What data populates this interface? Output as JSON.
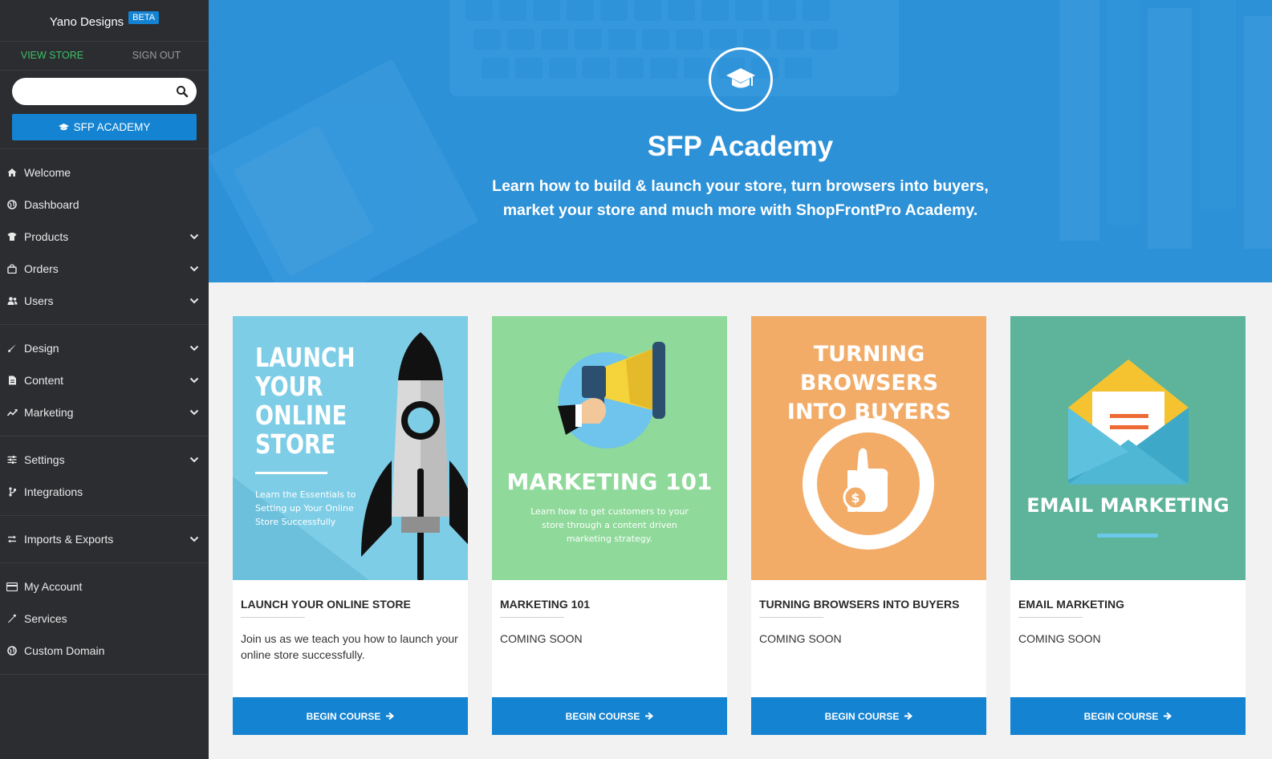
{
  "sidebar": {
    "brand": "Yano Designs",
    "beta_badge": "BETA",
    "view_store": "VIEW STORE",
    "sign_out": "SIGN OUT",
    "search_placeholder": "",
    "academy_button": "SFP ACADEMY",
    "groups": [
      [
        {
          "label": "Welcome",
          "icon": "home-icon",
          "expandable": false
        },
        {
          "label": "Dashboard",
          "icon": "globe-icon",
          "expandable": false
        },
        {
          "label": "Products",
          "icon": "shirt-icon",
          "expandable": true
        },
        {
          "label": "Orders",
          "icon": "bag-icon",
          "expandable": true
        },
        {
          "label": "Users",
          "icon": "users-icon",
          "expandable": true
        }
      ],
      [
        {
          "label": "Design",
          "icon": "brush-icon",
          "expandable": true
        },
        {
          "label": "Content",
          "icon": "document-icon",
          "expandable": true
        },
        {
          "label": "Marketing",
          "icon": "trend-icon",
          "expandable": true
        }
      ],
      [
        {
          "label": "Settings",
          "icon": "sliders-icon",
          "expandable": true
        },
        {
          "label": "Integrations",
          "icon": "branch-icon",
          "expandable": false
        }
      ],
      [
        {
          "label": "Imports & Exports",
          "icon": "exchange-icon",
          "expandable": true
        }
      ],
      [
        {
          "label": "My Account",
          "icon": "card-icon",
          "expandable": false
        },
        {
          "label": "Services",
          "icon": "wrench-icon",
          "expandable": false
        },
        {
          "label": "Custom Domain",
          "icon": "globe-icon",
          "expandable": false
        }
      ]
    ]
  },
  "hero": {
    "title": "SFP Academy",
    "subtitle": "Learn how to build & launch your store, turn browsers into buyers, market your store and much more with ShopFrontPro Academy."
  },
  "cards": [
    {
      "title": "LAUNCH YOUR ONLINE STORE",
      "description": "Join us as we teach you how to launch your online store successfully.",
      "button": "BEGIN COURSE",
      "image": {
        "bg": "#7ecde6",
        "heading": "LAUNCH YOUR ONLINE STORE",
        "caption": "Learn the Essentials to Setting up Your Online Store Successfully"
      }
    },
    {
      "title": "MARKETING 101",
      "description": "COMING SOON",
      "button": "BEGIN COURSE",
      "image": {
        "bg": "#8fd99a",
        "heading": "MARKETING 101",
        "caption": "Learn how to get customers to your store through a content driven marketing strategy."
      }
    },
    {
      "title": "TURNING BROWSERS INTO BUYERS",
      "description": "COMING SOON",
      "button": "BEGIN COURSE",
      "image": {
        "bg": "#f2ac68",
        "heading": "TURNING BROWSERS INTO BUYERS",
        "caption": ""
      }
    },
    {
      "title": "EMAIL MARKETING",
      "description": "COMING SOON",
      "button": "BEGIN COURSE",
      "image": {
        "bg": "#5db49a",
        "heading": "EMAIL MARKETING",
        "caption": ""
      }
    }
  ]
}
